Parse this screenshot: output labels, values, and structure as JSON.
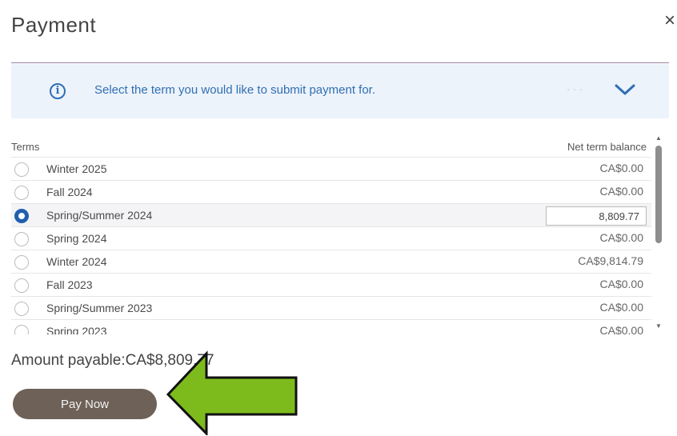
{
  "dialog": {
    "title": "Payment",
    "close_label": "×"
  },
  "info": {
    "icon": "info-icon",
    "message": "Select the term you would like to submit payment for.",
    "expand_icon": "chevron-down-icon"
  },
  "table": {
    "col_terms": "Terms",
    "col_balance": "Net term balance",
    "rows": [
      {
        "term": "Winter 2025",
        "balance": "CA$0.00",
        "selected": false
      },
      {
        "term": "Fall 2024",
        "balance": "CA$0.00",
        "selected": false
      },
      {
        "term": "Spring/Summer 2024",
        "balance": "",
        "amount_value": "8,809.77",
        "selected": true
      },
      {
        "term": "Spring 2024",
        "balance": "CA$0.00",
        "selected": false
      },
      {
        "term": "Winter 2024",
        "balance": "CA$9,814.79",
        "selected": false
      },
      {
        "term": "Fall 2023",
        "balance": "CA$0.00",
        "selected": false
      },
      {
        "term": "Spring/Summer 2023",
        "balance": "CA$0.00",
        "selected": false
      },
      {
        "term": "Spring 2023",
        "balance": "CA$0.00",
        "selected": false
      }
    ]
  },
  "summary": {
    "amount_payable": "Amount payable:CA$8,809.77"
  },
  "actions": {
    "pay_now": "Pay Now"
  },
  "colors": {
    "accent_blue": "#1f5fb0",
    "info_bg": "#edf3fb",
    "button_bg": "#6e6158",
    "arrow_green": "#7dbb1c"
  }
}
